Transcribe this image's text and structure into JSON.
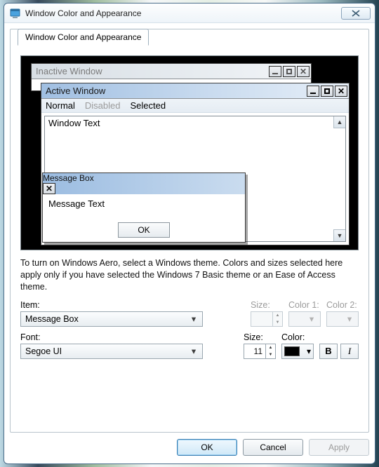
{
  "window": {
    "title": "Window Color and Appearance"
  },
  "tab": {
    "label": "Window Color and Appearance"
  },
  "preview": {
    "inactive_title": "Inactive Window",
    "active_title": "Active Window",
    "menu_normal": "Normal",
    "menu_disabled": "Disabled",
    "menu_selected": "Selected",
    "window_text": "Window Text",
    "msgbox_title": "Message Box",
    "msgbox_text": "Message Text",
    "msgbox_ok": "OK"
  },
  "description": "To turn on Windows Aero, select a Windows theme.  Colors and sizes selected here apply only if you have selected the Windows 7 Basic theme or an Ease of Access theme.",
  "form": {
    "item_label": "Item:",
    "item_value": "Message Box",
    "size1_label": "Size:",
    "size1_value": "",
    "color1_label": "Color 1:",
    "color2_label": "Color 2:",
    "font_label": "Font:",
    "font_value": "Segoe UI",
    "size2_label": "Size:",
    "size2_value": "11",
    "color_label": "Color:",
    "font_color": "#000000",
    "bold_label": "B",
    "italic_label": "I"
  },
  "buttons": {
    "ok": "OK",
    "cancel": "Cancel",
    "apply": "Apply"
  }
}
